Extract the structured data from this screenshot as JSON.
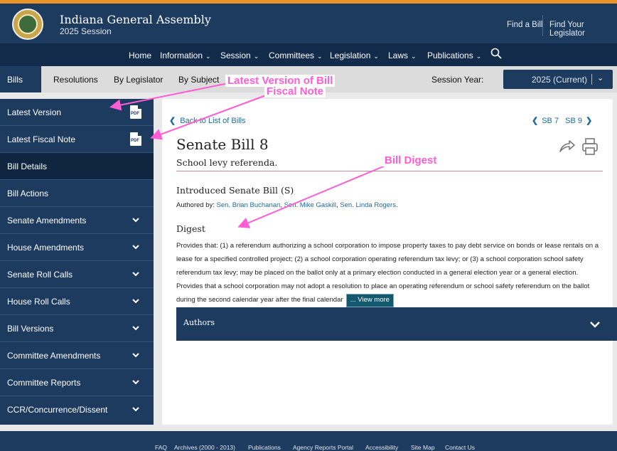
{
  "header": {
    "site_title": "Indiana General Assembly",
    "session": "2025 Session",
    "links": [
      "Find a Bill",
      "Find Your Legislator"
    ]
  },
  "main_nav": {
    "items": [
      "Home",
      "Information",
      "Session",
      "Committees",
      "Legislation",
      "Laws",
      "Publications"
    ]
  },
  "sub_nav": {
    "tabs": [
      "Bills",
      "Resolutions",
      "By Legislator",
      "By Subject"
    ],
    "session_year_label": "Session Year:",
    "session_year_value": "2025 (Current)"
  },
  "sidebar": {
    "items": [
      {
        "label": "Latest Version",
        "icon": "pdf-icon"
      },
      {
        "label": "Latest Fiscal Note",
        "icon": "pdf-icon"
      },
      {
        "label": "Bill Details",
        "icon": ""
      },
      {
        "label": "Bill Actions",
        "icon": ""
      },
      {
        "label": "Senate Amendments",
        "icon": "chevron-down-icon"
      },
      {
        "label": "House Amendments",
        "icon": "chevron-down-icon"
      },
      {
        "label": "Senate Roll Calls",
        "icon": "chevron-down-icon"
      },
      {
        "label": "House Roll Calls",
        "icon": "chevron-down-icon"
      },
      {
        "label": "Bill Versions",
        "icon": "chevron-down-icon"
      },
      {
        "label": "Committee Amendments",
        "icon": "chevron-down-icon"
      },
      {
        "label": "Committee Reports",
        "icon": "chevron-down-icon"
      },
      {
        "label": "CCR/Concurrence/Dissent",
        "icon": "chevron-down-icon"
      }
    ],
    "pdf_label": "PDF"
  },
  "content": {
    "back_link": "Back to List of Bills",
    "prev_bill": "SB 7",
    "next_bill": "SB 9",
    "bill_title": "Senate Bill 8",
    "bill_subtitle": "School levy referenda.",
    "version_heading": "Introduced Senate Bill (S)",
    "authored_prefix": "Authored by:",
    "authors": [
      "Sen. Brian Buchanan",
      "Sen. Mike Gaskill",
      "Sen. Linda Rogers"
    ],
    "digest_heading": "Digest",
    "digest_text": "Provides that: (1) a referendum authorizing a school corporation to impose property taxes to pay debt service on bonds or lease rentals on a lease for a specified controlled project; (2) a school corporation operating referendum tax levy; or (3) a school corporation school safety referendum tax levy; may be placed on the ballot only at a primary election conducted in a general election year or a general election. Provides that a school corporation may not adopt a resolution to place an operating referendum or school safety referendum on the ballot during the second calendar year after the final calendar",
    "view_more": "... View more",
    "authors_section": "Authors"
  },
  "footer": {
    "links": [
      "FAQ",
      "Archives (2000 - 2013)",
      "Publications",
      "Agency Reports Portal",
      "Accessibility",
      "Site Map",
      "Contact Us"
    ]
  },
  "annotations": {
    "latest_version": "Latest Version of Bill",
    "fiscal_note": "Fiscal Note",
    "bill_digest": "Bill Digest"
  },
  "colors": {
    "navy": "#1d3a5f",
    "link": "#1e6b99",
    "annotation": "#ff5cd6",
    "accent_bar": "#e8922a"
  }
}
